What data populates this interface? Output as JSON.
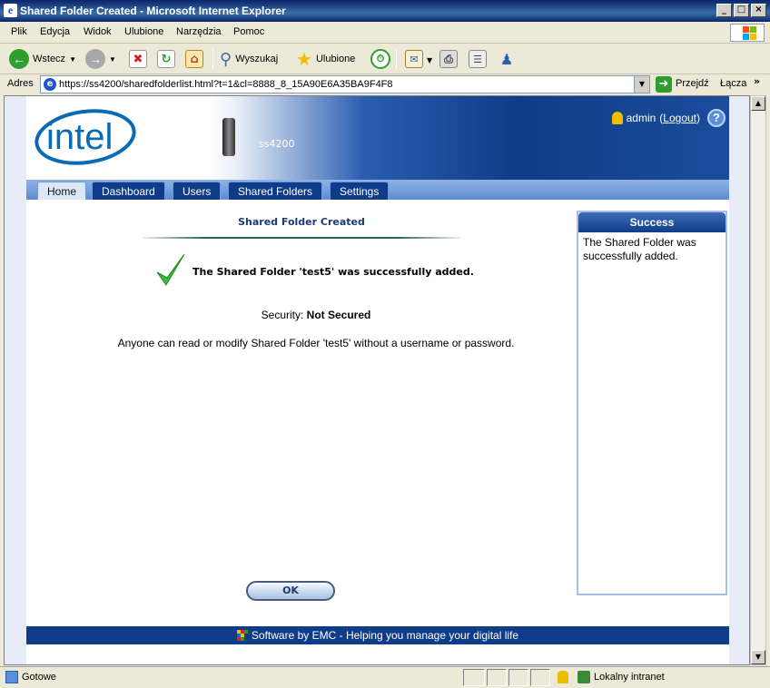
{
  "window": {
    "title": "Shared Folder Created - Microsoft Internet Explorer",
    "controls": [
      "_",
      "□",
      "×"
    ]
  },
  "menu": [
    "Plik",
    "Edycja",
    "Widok",
    "Ulubione",
    "Narzędzia",
    "Pomoc"
  ],
  "toolbar": {
    "back_label": "Wstecz",
    "search_label": "Wyszukaj",
    "favorites_label": "Ulubione"
  },
  "address": {
    "label": "Adres",
    "url": "https://ss4200/sharedfolderlist.html?t=1&cl=8888_8_15A90E6A35BA9F4F8",
    "go_label": "Przejdź",
    "links_label": "Łącza"
  },
  "header": {
    "logo_text": "intel",
    "device_name": "ss4200",
    "user": "admin",
    "logout_label": "Logout",
    "help_symbol": "?"
  },
  "tabs": [
    "Home",
    "Dashboard",
    "Users",
    "Shared Folders",
    "Settings"
  ],
  "main": {
    "title": "Shared Folder Created",
    "success_message": "The Shared Folder 'test5' was successfully added.",
    "security_label": "Security:",
    "security_value": "Not Secured",
    "warning": "Anyone can read or modify Shared Folder 'test5' without a username or password.",
    "ok_label": "OK"
  },
  "sidebar": {
    "title": "Success",
    "text": "The Shared Folder was successfully added."
  },
  "footer": {
    "text": "Software by EMC - Helping you manage your digital life"
  },
  "status": {
    "text": "Gotowe",
    "zone": "Lokalny intranet"
  },
  "colors": {
    "brand_blue": "#0f3c88",
    "check_green": "#3cb83c"
  }
}
